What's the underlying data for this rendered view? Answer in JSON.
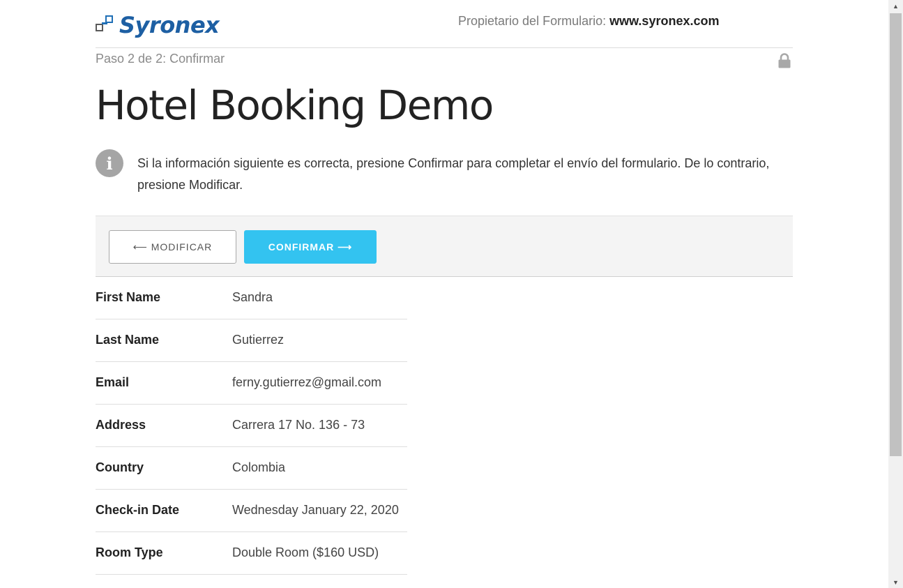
{
  "header": {
    "logo_text": "Syronex",
    "owner_label": "Propietario del Formulario:",
    "owner_site": "www.syronex.com"
  },
  "step": "Paso 2 de 2: Confirmar",
  "title": "Hotel Booking Demo",
  "info_text": "Si la información siguiente es correcta, presione Confirmar para completar el envío del formulario. De lo contrario, presione Modificar.",
  "buttons": {
    "modify": "⟵ MODIFICAR",
    "confirm": "CONFIRMAR ⟶"
  },
  "colors": {
    "confirm_button": "#33c3f0",
    "logo_blue": "#1d5fa3"
  },
  "fields": [
    {
      "label": "First Name",
      "value": "Sandra"
    },
    {
      "label": "Last Name",
      "value": "Gutierrez"
    },
    {
      "label": "Email",
      "value": "ferny.gutierrez@gmail.com"
    },
    {
      "label": "Address",
      "value": "Carrera 17 No. 136 - 73"
    },
    {
      "label": "Country",
      "value": "Colombia"
    },
    {
      "label": "Check-in Date",
      "value": "Wednesday January 22, 2020"
    },
    {
      "label": "Room Type",
      "value": "Double Room ($160 USD)"
    }
  ]
}
